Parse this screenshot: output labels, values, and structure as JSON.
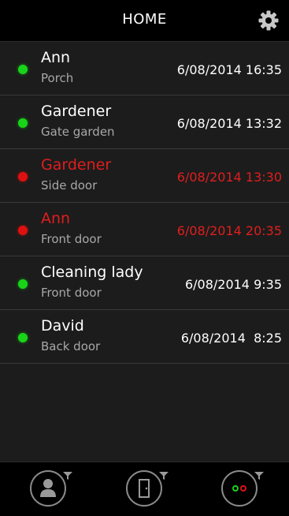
{
  "header": {
    "title": "HOME",
    "settings_icon": "gear-icon"
  },
  "events": [
    {
      "name": "Ann",
      "location": "Porch",
      "time": "6/08/2014 16:35",
      "status": "granted"
    },
    {
      "name": "Gardener",
      "location": "Gate garden",
      "time": "6/08/2014 13:32",
      "status": "granted"
    },
    {
      "name": "Gardener",
      "location": "Side door",
      "time": "6/08/2014 13:30",
      "status": "denied"
    },
    {
      "name": "Ann",
      "location": "Front door",
      "time": "6/08/2014 20:35",
      "status": "denied"
    },
    {
      "name": "Cleaning lady",
      "location": "Front door",
      "time": "6/08/2014 9:35",
      "status": "granted"
    },
    {
      "name": "David",
      "location": "Back door",
      "time": "6/08/2014  8:25",
      "status": "granted"
    }
  ],
  "footer": {
    "buttons": [
      {
        "icon": "person-filter-icon"
      },
      {
        "icon": "door-filter-icon"
      },
      {
        "icon": "status-filter-icon"
      }
    ]
  },
  "colors": {
    "granted": "#18d418",
    "denied": "#e01010",
    "header_bg": "#000000",
    "list_bg": "#1c1c1c"
  }
}
